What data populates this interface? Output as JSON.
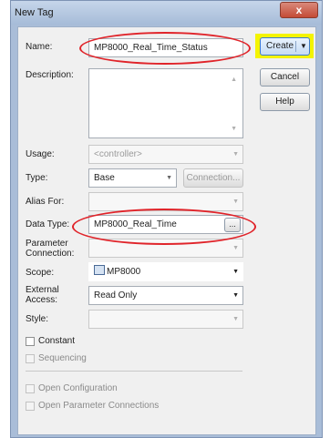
{
  "dialog": {
    "title": "New Tag",
    "close_glyph": "x"
  },
  "form": {
    "name": {
      "label": "Name:",
      "value": "MP8000_Real_Time_Status"
    },
    "description": {
      "label": "Description:"
    },
    "usage": {
      "label": "Usage:",
      "value": "<controller>"
    },
    "type": {
      "label": "Type:",
      "value": "Base",
      "connection_button": "Connection..."
    },
    "alias_for": {
      "label": "Alias For:"
    },
    "data_type": {
      "label": "Data Type:",
      "value": "MP8000_Real_Time",
      "browse_button": "..."
    },
    "parameter_connection": {
      "label": "Parameter Connection:"
    },
    "scope": {
      "label": "Scope:",
      "value": "MP8000",
      "icon": "controller-icon"
    },
    "external_access": {
      "label": "External Access:",
      "value": "Read Only"
    },
    "style": {
      "label": "Style:"
    }
  },
  "checkboxes": {
    "constant": "Constant",
    "sequencing": "Sequencing",
    "open_configuration": "Open Configuration",
    "open_parameter_connections": "Open Parameter Connections"
  },
  "buttons": {
    "create": "Create",
    "cancel": "Cancel",
    "help": "Help"
  },
  "colors": {
    "highlight": "#f4f400",
    "annotation": "#e0242a",
    "title_bar": "#b5c8e2"
  }
}
